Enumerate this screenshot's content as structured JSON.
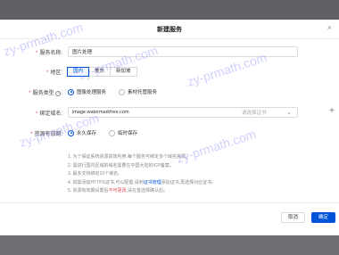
{
  "dialog": {
    "title": "新建服务",
    "close_glyph": "×"
  },
  "form": {
    "service_name": {
      "label": "服务名称:",
      "value": "图片处理"
    },
    "region": {
      "label": "地区:",
      "options": [
        "国内",
        "美东",
        "新加坡"
      ],
      "selected": "国内"
    },
    "service_type": {
      "label": "服务类型",
      "options": [
        "图像处理服务",
        "素材托管服务"
      ],
      "selected": "图像处理服务"
    },
    "domain": {
      "label": "绑定域名:",
      "value": "image.watermarkfree.com",
      "placeholder": "请选择证书"
    },
    "cache": {
      "label": "资源有效期:",
      "options": [
        "永久保存",
        "临时保存"
      ],
      "selected": "永久保存"
    }
  },
  "notes": {
    "n1": "1. 为了保证系统资源高效利用,每个服务可绑定多个域名资源。",
    "n2": "2. 需进行国内区域的域名需要在中国大陆的ICP备案。",
    "n3": "3. 最多支持绑定10个域名。",
    "n4_pre": "4. 如需添加HTTPS证书,可以配置,请到",
    "n4_link": "证书管理",
    "n4_post": "添加证书,再选择对应证书。",
    "n5_pre": "5. 资源有效期设置后",
    "n5_red": "不可更改",
    "n5_post": ",请在首选择确认后。"
  },
  "footer": {
    "cancel_label": "取消",
    "ok_label": "确定"
  },
  "watermark": {
    "text": "zy-prmath.com"
  },
  "colors": {
    "primary": "#0052d9",
    "danger": "#e34d59",
    "overlay": "#6f7076"
  }
}
